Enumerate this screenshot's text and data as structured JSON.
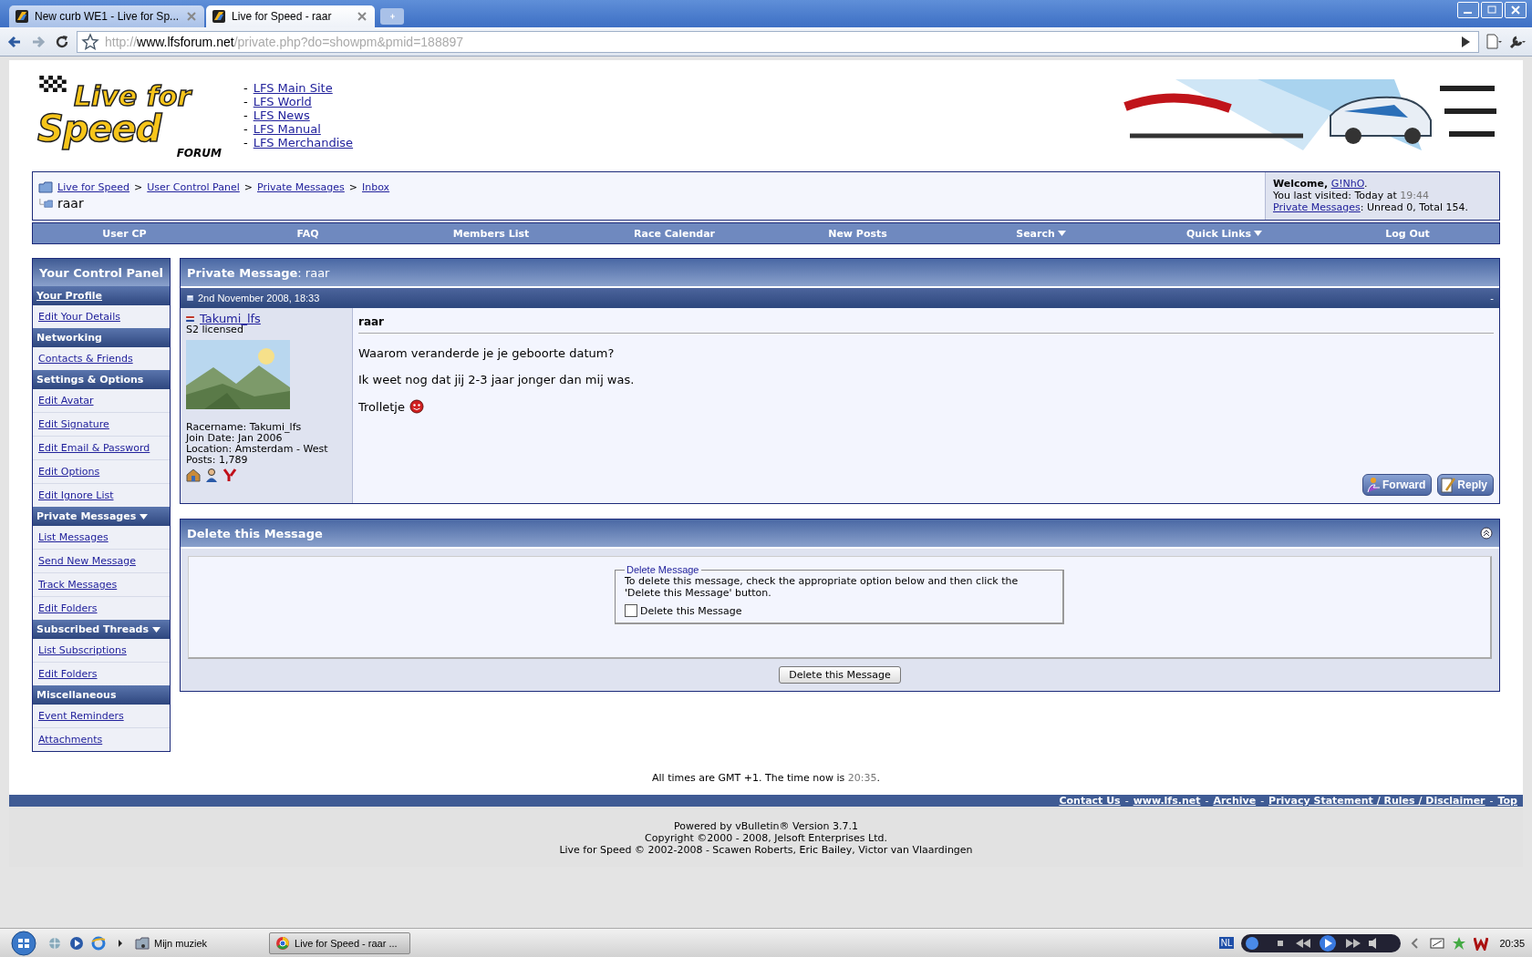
{
  "browser": {
    "tabs": [
      {
        "title": "New curb WE1 - Live for Sp...",
        "selected": false
      },
      {
        "title": "Live for Speed - raar",
        "selected": true
      }
    ],
    "url": {
      "scheme": "http://",
      "host": "www.lfsforum.net",
      "path": "/private.php?do=showpm&pmid=188897"
    }
  },
  "header": {
    "logo": {
      "lines": [
        "Live for",
        "Speed"
      ],
      "tag": "FORUM"
    },
    "links": [
      {
        "dash": "-",
        "label": "LFS Main Site"
      },
      {
        "dash": "-",
        "label": "LFS World"
      },
      {
        "dash": "-",
        "label": "LFS News"
      },
      {
        "dash": "-",
        "label": "LFS Manual"
      },
      {
        "dash": "-",
        "label": "LFS Merchandise"
      }
    ],
    "banner": {
      "kind": "picture"
    }
  },
  "breadcrumb": {
    "items": [
      {
        "label": "Live for Speed",
        "sep": ">"
      },
      {
        "label": "User Control Panel",
        "sep": ">"
      },
      {
        "label": "Private Messages",
        "sep": ">"
      },
      {
        "label": "Inbox"
      }
    ],
    "current": "raar"
  },
  "welcome": {
    "label": "Welcome,",
    "user": "G!NhO",
    "end": ".",
    "last_visit": "You last visited: Today at",
    "last_time": "19:44",
    "pm_link": "Private Messages",
    "pm_text": ": Unread 0, Total 154."
  },
  "navbar": [
    {
      "label": "User CP",
      "dropdown": false
    },
    {
      "label": "FAQ",
      "dropdown": false
    },
    {
      "label": "Members List",
      "dropdown": false
    },
    {
      "label": "Race Calendar",
      "dropdown": false
    },
    {
      "label": "New Posts",
      "dropdown": false
    },
    {
      "label": "Search",
      "dropdown": true
    },
    {
      "label": "Quick Links",
      "dropdown": true
    },
    {
      "label": "Log Out",
      "dropdown": false
    }
  ],
  "sidebar": {
    "title": "Your Control Panel",
    "sections": [
      {
        "heading": "Your Profile",
        "link": true,
        "dropdown": false,
        "items": [
          "Edit Your Details"
        ]
      },
      {
        "heading": "Networking",
        "link": false,
        "dropdown": false,
        "items": [
          "Contacts & Friends"
        ]
      },
      {
        "heading": "Settings & Options",
        "link": false,
        "dropdown": false,
        "items": [
          "Edit Avatar",
          "Edit Signature",
          "Edit Email & Password",
          "Edit Options",
          "Edit Ignore List"
        ]
      },
      {
        "heading": "Private Messages",
        "link": false,
        "dropdown": true,
        "items": [
          "List Messages",
          "Send New Message",
          "Track Messages",
          "Edit Folders"
        ]
      },
      {
        "heading": "Subscribed Threads",
        "link": false,
        "dropdown": true,
        "items": [
          "List Subscriptions",
          "Edit Folders"
        ]
      },
      {
        "heading": "Miscellaneous",
        "link": false,
        "dropdown": false,
        "items": [
          "Event Reminders",
          "Attachments"
        ]
      }
    ]
  },
  "message": {
    "title": "**Private Message**: raar",
    "date": "2nd November 2008, 18:33",
    "collapse": "-",
    "author": {
      "name": "Takumi_lfs",
      "rank": "S2 licensed",
      "avatar": {
        "kind": "picture"
      },
      "details": [
        "Racername: Takumi_lfs",
        "Join Date: Jan 2006",
        "Location: Amsterdam - West",
        "Posts: 1,789"
      ]
    },
    "subject": "raar",
    "paragraphs": [
      "Waarom veranderde je je geboorte datum?",
      "Ik weet nog dat jij 2-3 jaar jonger dan mij was.",
      "Trolletje"
    ],
    "buttons": [
      "Forward",
      "Reply"
    ]
  },
  "delete": {
    "title": "Delete this Message",
    "legend": "Delete Message",
    "text": "To delete this message, check the appropriate option below and then click the 'Delete this Message' button.",
    "checkbox": {
      "label": "Delete this Message",
      "checked": false
    },
    "button": "Delete this Message"
  },
  "footer": {
    "time_text": "All times are GMT +1. The time now is",
    "time": "20:35",
    "time_end": ".",
    "links": [
      {
        "label": "Contact Us"
      },
      {
        "sep": "-",
        "label": "www.lfs.net"
      },
      {
        "sep": "-",
        "label": "Archive"
      },
      {
        "sep": "-",
        "label": "Privacy Statement / Rules / Disclaimer"
      },
      {
        "sep": "-",
        "label": "Top"
      }
    ],
    "credits": [
      "Powered by vBulletin® Version 3.7.1",
      "Copyright ©2000 - 2008, Jelsoft Enterprises Ltd.",
      "Live for Speed © 2002-2008 - Scawen Roberts, Eric Bailey, Victor van Vlaardingen"
    ]
  },
  "taskbar": {
    "folder": "Mijn muziek",
    "task": "Live for Speed - raar ...",
    "lang": "NL",
    "clock": "20:35"
  }
}
